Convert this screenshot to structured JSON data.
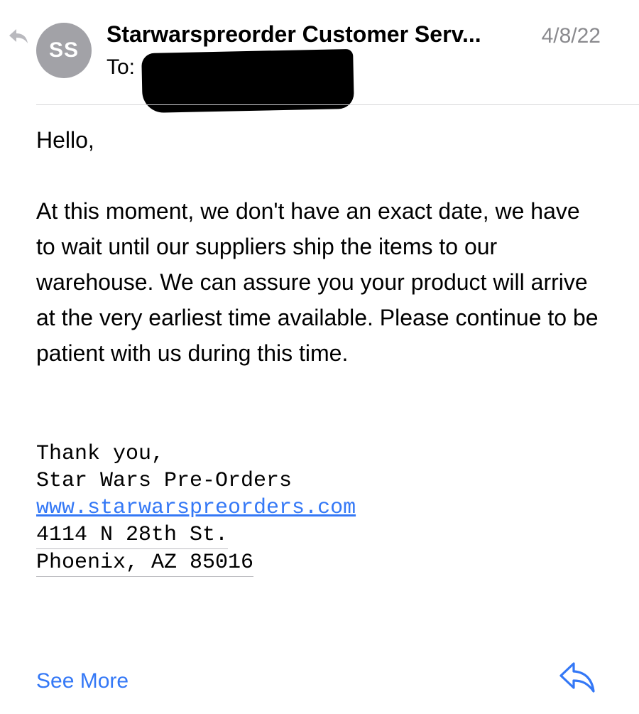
{
  "header": {
    "avatar_initials": "SS",
    "sender": "Starwarspreorder Customer Serv...",
    "date": "4/8/22",
    "to_label": "To:",
    "replied_icon": "reply-arrow-icon"
  },
  "body": {
    "greeting": "Hello,",
    "message": "At this moment, we don't have an exact date, we have to wait until our suppliers ship the items to our warehouse. We can assure you your product will arrive at the very earliest time available. Please continue to be patient with us during this time."
  },
  "signature": {
    "line1": "Thank you,",
    "line2": "Star Wars Pre-Orders",
    "website": "www.starwarspreorders.com",
    "address_line1": "4114 N 28th St.",
    "address_line2": "Phoenix, AZ 85016"
  },
  "footer": {
    "see_more": "See More",
    "reply_icon": "reply-icon"
  },
  "colors": {
    "accent": "#3478f6",
    "avatar_bg": "#a2a2a7",
    "secondary_text": "#8a8a8e"
  }
}
